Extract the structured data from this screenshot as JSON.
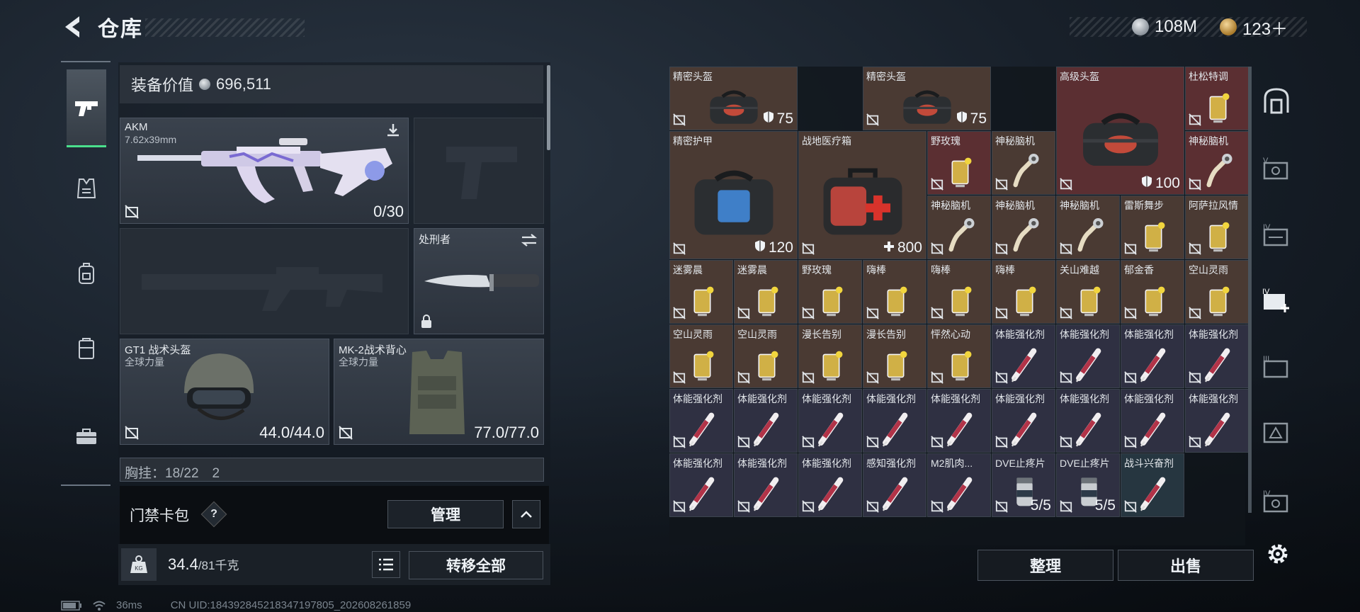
{
  "header": {
    "title": "仓库"
  },
  "currency": {
    "silver": "108M",
    "gold": "123＋"
  },
  "equip": {
    "value_label": "装备价值",
    "value": "696,511",
    "primary": {
      "name": "AKM",
      "caliber": "7.62x39mm",
      "ammo": "0/30"
    },
    "melee": {
      "name": "处刑者"
    },
    "helmet": {
      "name": "GT1 战术头盔",
      "sub": "全球力量",
      "durability": "44.0/44.0"
    },
    "armor": {
      "name": "MK-2战术背心",
      "sub": "全球力量",
      "durability": "77.0/77.0"
    },
    "chest_partial": "胸挂：18/22　2"
  },
  "card_bar": {
    "label": "门禁卡包",
    "help": "?",
    "manage": "管理"
  },
  "weight": {
    "current": "34.4",
    "max": "/81千克"
  },
  "transfer_all": "转移全部",
  "status": {
    "ping": "36ms",
    "uid": "CN UID:184392845218347197805_202608261859"
  },
  "grid": {
    "cells": [
      {
        "name": "精密头盔",
        "value": "75",
        "color": "brown",
        "icon": "duffel-bag-icon"
      },
      {
        "name": "精密头盔",
        "value": "75",
        "color": "brown",
        "icon": "duffel-bag-icon"
      },
      {
        "name": "高级头盔",
        "value": "100",
        "color": "red",
        "icon": "duffel-bag-icon"
      },
      {
        "name": "杜松特调",
        "value": "",
        "color": "red",
        "icon": "cocktail-icon"
      },
      {
        "name": "精密护甲",
        "value": "120",
        "color": "brown",
        "icon": "armor-case-icon"
      },
      {
        "name": "战地医疗箱",
        "value": "800",
        "color": "brown",
        "icon": "medkit-icon"
      },
      {
        "name": "野玫瑰",
        "value": "",
        "color": "red",
        "icon": "cocktail-icon"
      },
      {
        "name": "神秘脑机",
        "value": "",
        "color": "brown",
        "icon": "brain-device-icon"
      },
      {
        "name": "神秘脑机",
        "value": "",
        "color": "red",
        "icon": "brain-device-icon"
      },
      {
        "name": "神秘脑机",
        "value": "",
        "color": "brown",
        "icon": "brain-device-icon"
      },
      {
        "name": "神秘脑机",
        "value": "",
        "color": "brown",
        "icon": "brain-device-icon"
      },
      {
        "name": "神秘脑机",
        "value": "",
        "color": "brown",
        "icon": "brain-device-icon"
      },
      {
        "name": "神秘脑机",
        "value": "",
        "color": "brown",
        "icon": "brain-device-icon"
      },
      {
        "name": "雷斯舞步",
        "value": "",
        "color": "brown",
        "icon": "cocktail-icon"
      },
      {
        "name": "阿萨拉风情",
        "value": "",
        "color": "brown",
        "icon": "cocktail-icon"
      },
      {
        "name": "迷雾晨",
        "value": "",
        "color": "brown",
        "icon": "cocktail-icon"
      },
      {
        "name": "迷雾晨",
        "value": "",
        "color": "brown",
        "icon": "cocktail-icon"
      },
      {
        "name": "野玫瑰",
        "value": "",
        "color": "brown",
        "icon": "cocktail-icon"
      },
      {
        "name": "嗨棒",
        "value": "",
        "color": "brown",
        "icon": "cocktail-icon"
      },
      {
        "name": "嗨棒",
        "value": "",
        "color": "brown",
        "icon": "cocktail-icon"
      },
      {
        "name": "嗨棒",
        "value": "",
        "color": "brown",
        "icon": "cocktail-icon"
      },
      {
        "name": "关山难越",
        "value": "",
        "color": "brown",
        "icon": "cocktail-icon"
      },
      {
        "name": "郁金香",
        "value": "",
        "color": "brown",
        "icon": "cocktail-icon"
      },
      {
        "name": "空山灵雨",
        "value": "",
        "color": "brown",
        "icon": "cocktail-icon"
      },
      {
        "name": "空山灵雨",
        "value": "",
        "color": "brown",
        "icon": "cocktail-icon"
      },
      {
        "name": "空山灵雨",
        "value": "",
        "color": "brown",
        "icon": "cocktail-icon"
      },
      {
        "name": "漫长告别",
        "value": "",
        "color": "brown",
        "icon": "cocktail-icon"
      },
      {
        "name": "漫长告别",
        "value": "",
        "color": "brown",
        "icon": "cocktail-icon"
      },
      {
        "name": "怦然心动",
        "value": "",
        "color": "brown",
        "icon": "cocktail-icon"
      },
      {
        "name": "体能强化剂",
        "value": "",
        "color": "purple",
        "icon": "syringe-icon"
      },
      {
        "name": "体能强化剂",
        "value": "",
        "color": "purple",
        "icon": "syringe-icon"
      },
      {
        "name": "体能强化剂",
        "value": "",
        "color": "purple",
        "icon": "syringe-icon"
      },
      {
        "name": "体能强化剂",
        "value": "",
        "color": "purple",
        "icon": "syringe-icon"
      },
      {
        "name": "体能强化剂",
        "value": "",
        "color": "purple",
        "icon": "syringe-icon"
      },
      {
        "name": "体能强化剂",
        "value": "",
        "color": "purple",
        "icon": "syringe-icon"
      },
      {
        "name": "体能强化剂",
        "value": "",
        "color": "purple",
        "icon": "syringe-icon"
      },
      {
        "name": "体能强化剂",
        "value": "",
        "color": "purple",
        "icon": "syringe-icon"
      },
      {
        "name": "体能强化剂",
        "value": "",
        "color": "purple",
        "icon": "syringe-icon"
      },
      {
        "name": "体能强化剂",
        "value": "",
        "color": "purple",
        "icon": "syringe-icon"
      },
      {
        "name": "体能强化剂",
        "value": "",
        "color": "purple",
        "icon": "syringe-icon"
      },
      {
        "name": "体能强化剂",
        "value": "",
        "color": "purple",
        "icon": "syringe-icon"
      },
      {
        "name": "体能强化剂",
        "value": "",
        "color": "purple",
        "icon": "syringe-icon"
      },
      {
        "name": "体能强化剂",
        "value": "",
        "color": "purple",
        "icon": "syringe-icon"
      },
      {
        "name": "体能强化剂",
        "value": "",
        "color": "purple",
        "icon": "syringe-icon"
      },
      {
        "name": "体能强化剂",
        "value": "",
        "color": "purple",
        "icon": "syringe-icon"
      },
      {
        "name": "感知强化剂",
        "value": "",
        "color": "purple",
        "icon": "syringe-icon"
      },
      {
        "name": "M2肌肉...",
        "value": "",
        "color": "purple",
        "icon": "syringe-icon"
      },
      {
        "name": "DVE止疼片",
        "value": "5/5",
        "color": "purple",
        "icon": "pill-bottle-icon"
      },
      {
        "name": "DVE止疼片",
        "value": "5/5",
        "color": "purple",
        "icon": "pill-bottle-icon"
      },
      {
        "name": "战斗兴奋剂",
        "value": "",
        "color": "teal",
        "icon": "syringe-icon"
      }
    ]
  },
  "actions": {
    "sort": "整理",
    "sell": "出售"
  }
}
